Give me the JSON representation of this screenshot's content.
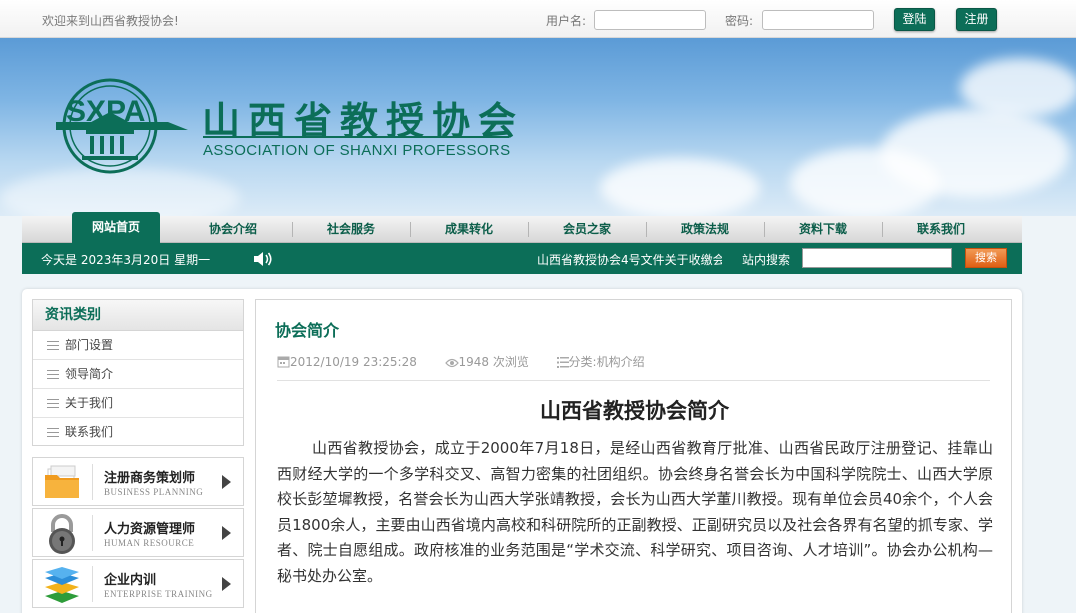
{
  "topbar": {
    "welcome": "欢迎来到山西省教授协会!",
    "username_label": "用户名:",
    "password_label": "密码:",
    "login_label": "登陆",
    "register_label": "注册"
  },
  "banner": {
    "logo_text": "SXPA",
    "title_cn": "山西省教授协会",
    "title_en": "ASSOCIATION OF SHANXI PROFESSORS"
  },
  "nav": {
    "items": [
      {
        "label": "网站首页"
      },
      {
        "label": "协会介绍"
      },
      {
        "label": "社会服务"
      },
      {
        "label": "成果转化"
      },
      {
        "label": "会员之家"
      },
      {
        "label": "政策法规"
      },
      {
        "label": "资料下载"
      },
      {
        "label": "联系我们"
      }
    ],
    "active": "网站首页"
  },
  "infobar": {
    "date": "今天是 2023年3月20日   星期一",
    "marquee": "山西省教授协会4号文件关于收缴会",
    "search_label": "站内搜索",
    "search_value": "",
    "search_button": "搜索"
  },
  "sidebar": {
    "heading": "资讯类别",
    "items": [
      {
        "label": "部门设置"
      },
      {
        "label": "领导简介"
      },
      {
        "label": "关于我们"
      },
      {
        "label": "联系我们"
      }
    ],
    "services": [
      {
        "cn": "注册商务策划师",
        "en": "BUSINESS PLANNING",
        "icon": "folder-icon"
      },
      {
        "cn": "人力资源管理师",
        "en": "HUMAN RESOURCE",
        "icon": "padlock-icon"
      },
      {
        "cn": "企业内训",
        "en": "ENTERPRISE TRAINING",
        "icon": "layers-icon"
      }
    ]
  },
  "article": {
    "section": "协会简介",
    "datetime": "2012/10/19 23:25:28",
    "views": "1948 次浏览",
    "category": "分类:机构介绍",
    "title": "山西省教授协会简介",
    "body": "山西省教授协会，成立于2000年7月18日，是经山西省教育厅批准、山西省民政厅注册登记、挂靠山西财经大学的一个多学科交叉、高智力密集的社团组织。协会终身名誉会长为中国科学院院士、山西大学原校长彭堃墀教授，名誉会长为山西大学张靖教授，会长为山西大学董川教授。现有单位会员40余个，个人会员1800余人，主要由山西省境内高校和科研院所的正副教授、正副研究员以及社会各界有名望的抓专家、学者、院士自愿组成。政府核准的业务范围是“学术交流、科学研究、项目咨询、人才培训”。协会办公机构—秘书处办公室。"
  },
  "colors": {
    "brand_green": "#0c6e58",
    "search_orange": "#e8702a"
  }
}
